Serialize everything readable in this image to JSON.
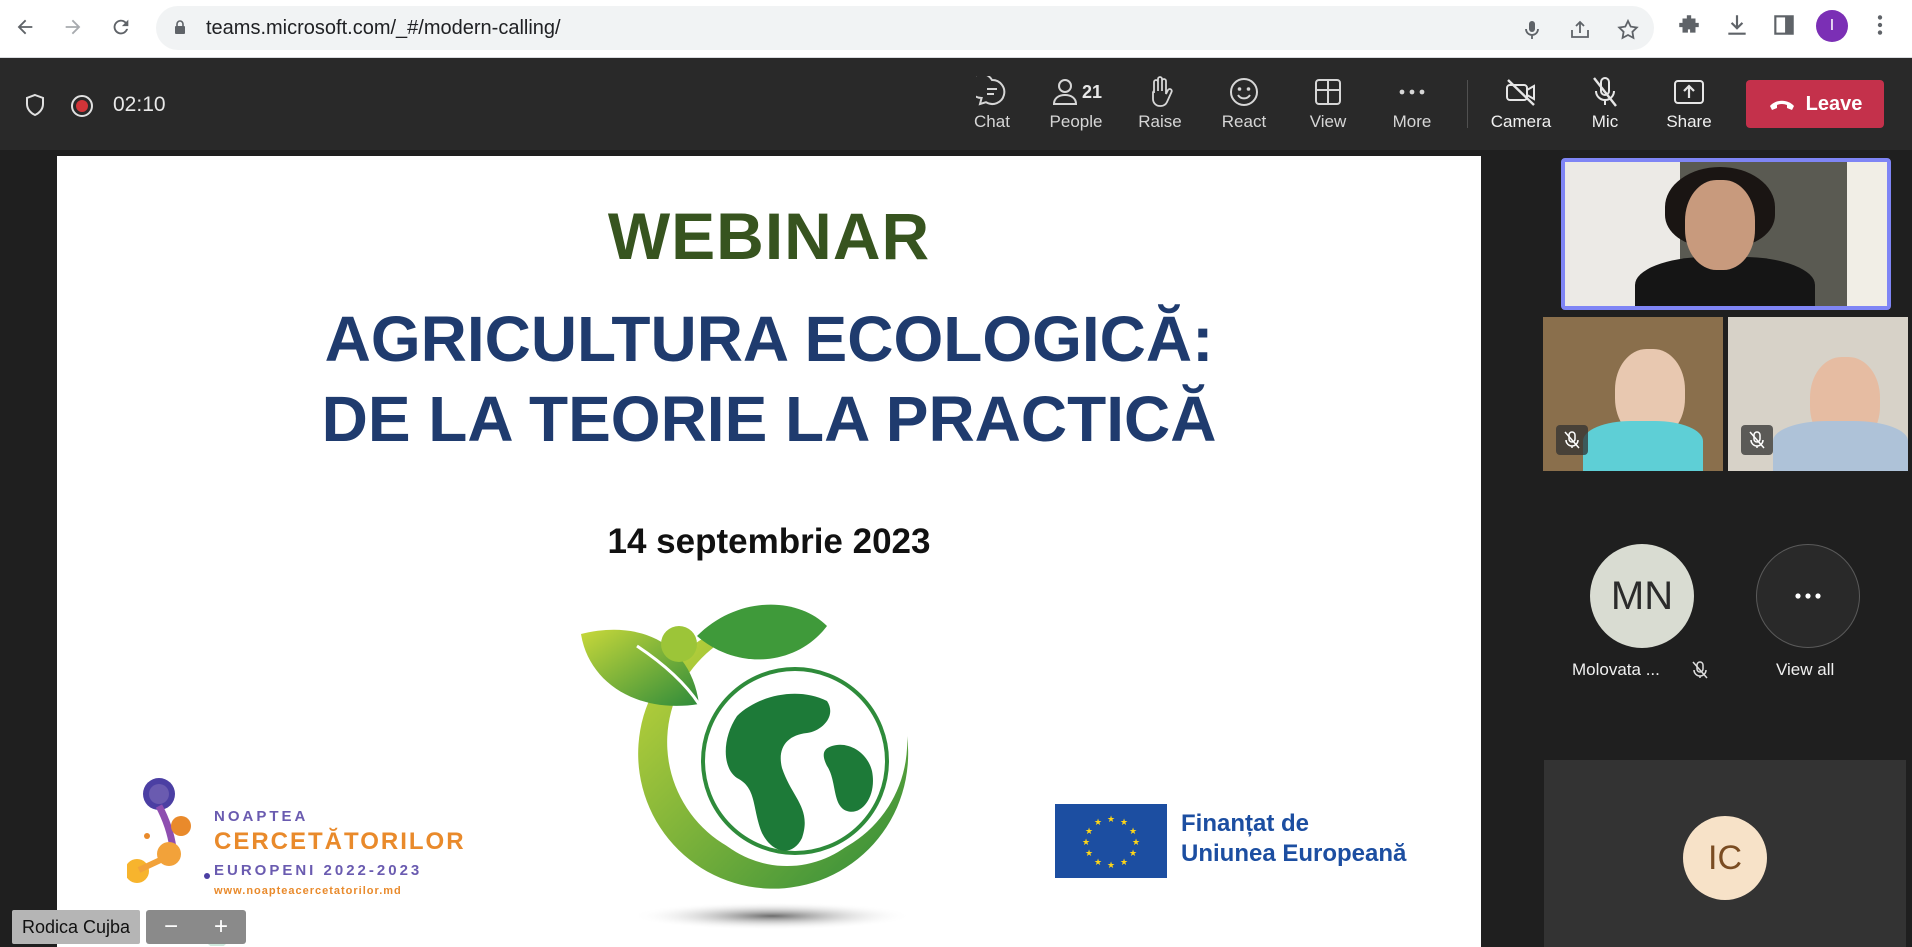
{
  "browser": {
    "url": "teams.microsoft.com/_#/modern-calling/",
    "profile_initial": "I"
  },
  "meeting": {
    "timer": "02:10",
    "toolbar": {
      "chat": "Chat",
      "people": "People",
      "people_count": "21",
      "raise": "Raise",
      "react": "React",
      "view": "View",
      "more": "More",
      "camera": "Camera",
      "mic": "Mic",
      "share": "Share",
      "leave": "Leave"
    },
    "presenter_name": "Rodica Cujba"
  },
  "slide": {
    "title": "WEBINAR",
    "subtitle_line1": "AGRICULTURA ECOLOGICĂ:",
    "subtitle_line2": "DE LA TEORIE LA PRACTICĂ",
    "date": "14 septembrie 2023",
    "left_logo": {
      "line1": "NOAPTEA",
      "line2": "CERCETĂTORILOR",
      "line3": "EUROPENI 2022-2023",
      "url": "www.noapteacercetatorilor.md"
    },
    "eu_logo": {
      "line1": "Finanțat de",
      "line2": "Uniunea Europeană"
    }
  },
  "participants": {
    "mn_initials": "MN",
    "mn_name": "Molovata ...",
    "view_all": "View all",
    "ic_initials": "IC"
  },
  "colors": {
    "leave_red": "#c4314b",
    "active_speaker_border": "#7f85f5",
    "webinar_green": "#37541f",
    "title_blue": "#1f3b6e"
  }
}
